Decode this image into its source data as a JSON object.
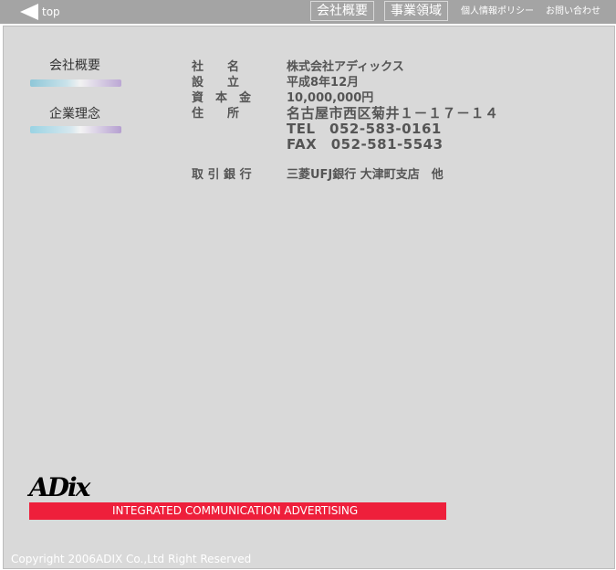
{
  "header": {
    "top_link": "top",
    "nav": [
      "会社概要",
      "事業領域"
    ],
    "privacy": "個人情報ポリシー",
    "contact": "お問い合わせ"
  },
  "sidebar": {
    "items": [
      {
        "label": "会社概要"
      },
      {
        "label": "企業理念"
      }
    ]
  },
  "company": {
    "rows": [
      {
        "label": "社　　名",
        "value": "株式会社アディックス"
      },
      {
        "label": "設　　立",
        "value": "平成8年12月"
      },
      {
        "label": "資　本　金",
        "value": "10,000,000円"
      },
      {
        "label": "住　　所",
        "value": "名古屋市西区菊井１－１７－１４"
      },
      {
        "label": "",
        "value": "TEL　052-583-0161"
      },
      {
        "label": "",
        "value": "FAX　052-581-5543"
      }
    ],
    "bank": {
      "label": "取 引 銀 行",
      "value": "三菱UFJ銀行 大津町支店　他"
    }
  },
  "footer": {
    "logo": "ADix",
    "tagline": "INTEGRATED COMMUNICATION ADVERTISING",
    "copyright": "Copyright 2006ADIX Co.,Ltd Right Reserved"
  },
  "colors": {
    "header_bg": "#a4a4a4",
    "panel_bg": "#d9d9d9",
    "tagline_bg": "#ee1f3b",
    "text": "#555555"
  }
}
